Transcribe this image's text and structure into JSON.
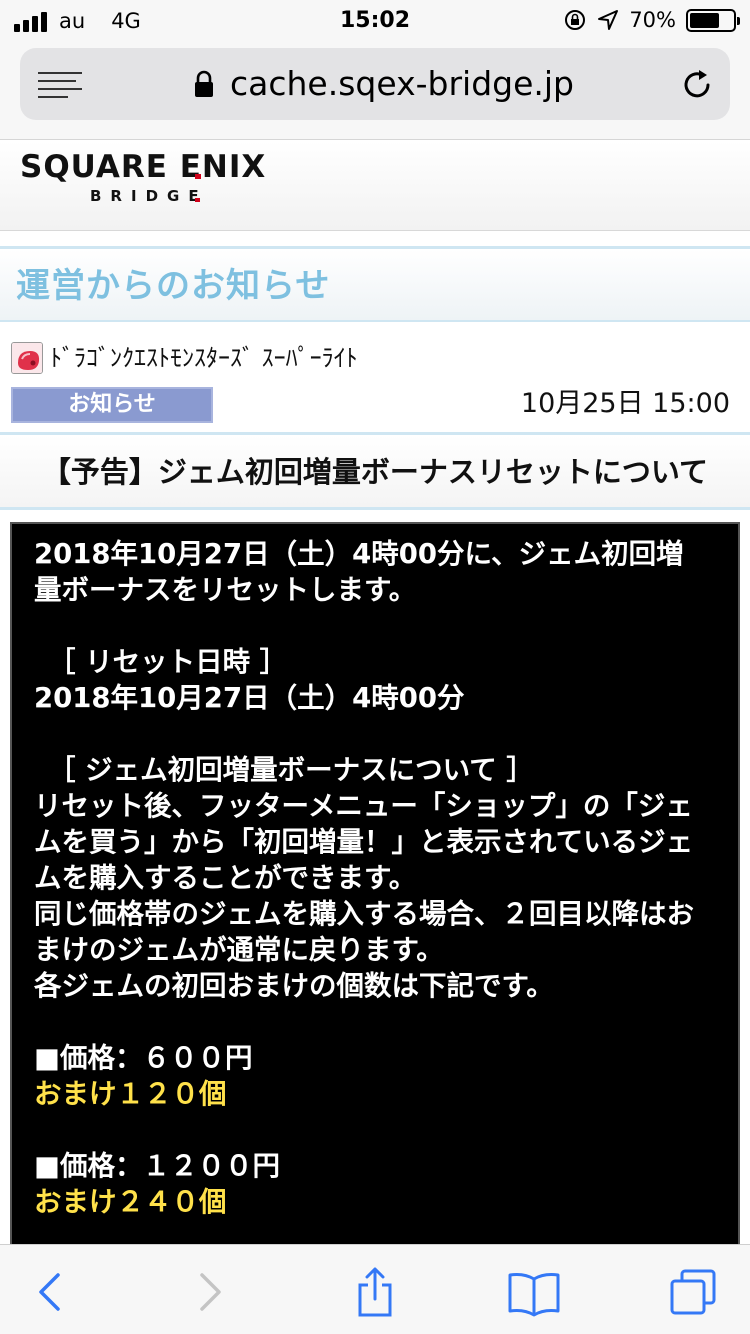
{
  "status_bar": {
    "carrier": "au",
    "network": "4G",
    "time": "15:02",
    "battery_text": "70%",
    "battery_level": 0.7
  },
  "browser": {
    "url": "cache.sqex-bridge.jp"
  },
  "logo": {
    "main": "SQUARE ENIX",
    "sub": "BRIDGE"
  },
  "section": {
    "title": "運営からのお知らせ"
  },
  "notice": {
    "game_name": "ﾄﾞﾗｺﾞﾝｸｴｽﾄﾓﾝｽﾀｰｽﾞ ｽｰﾊﾟｰﾗｲﾄ",
    "category": "お知らせ",
    "date": "10月25日 15:00",
    "title": "【予告】ジェム初回増量ボーナスリセットについて"
  },
  "body": {
    "l1": "2018年10月27日（土）4時00分に、ジェム初回増",
    "l2": "量ボーナスをリセットします。",
    "l3": "［ リセット日時 ］",
    "l4": "2018年10月27日（土）4時00分",
    "l5": "［ ジェム初回増量ボーナスについて ］",
    "l6": "リセット後、フッターメニュー「ショップ」の「ジェ",
    "l7": "ムを買う」から「初回増量！」と表示されているジェ",
    "l8": "ムを購入することができます。",
    "l9": "同じ価格帯のジェムを購入する場合、２回目以降はお",
    "l10": "まけのジェムが通常に戻ります。",
    "l11": "各ジェムの初回おまけの個数は下記です。",
    "price1": "■価格：６００円",
    "bonus1": "おまけ１２０個",
    "price2": "■価格：１２００円",
    "bonus2": "おまけ２４０個"
  },
  "colors": {
    "section_title": "#7ec0e0",
    "bonus_text": "#ffe14a",
    "badge": "#8a9ad0",
    "ios_blue": "#3478f6"
  },
  "toolbar": {
    "icons": [
      "back-icon",
      "forward-icon",
      "share-icon",
      "bookmarks-icon",
      "tabs-icon"
    ]
  }
}
